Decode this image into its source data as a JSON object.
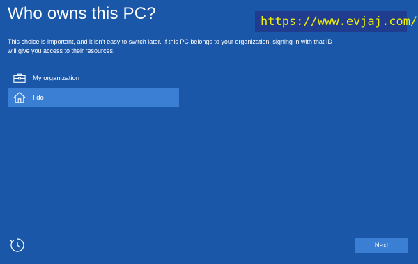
{
  "title": "Who owns this PC?",
  "watermark": "https://www.evjaj.com/",
  "description": "This choice is important, and it isn't easy to switch later. If this PC belongs to your organization, signing in with that ID will give you access to their resources.",
  "options": [
    {
      "label": "My organization",
      "icon": "briefcase-icon",
      "selected": false
    },
    {
      "label": "I do",
      "icon": "home-icon",
      "selected": true
    }
  ],
  "footer": {
    "accessibility_icon": "ease-of-access-icon",
    "next_label": "Next"
  },
  "colors": {
    "background": "#1a57a8",
    "selected": "#3b7fd4",
    "watermark_text": "#f0f000"
  }
}
